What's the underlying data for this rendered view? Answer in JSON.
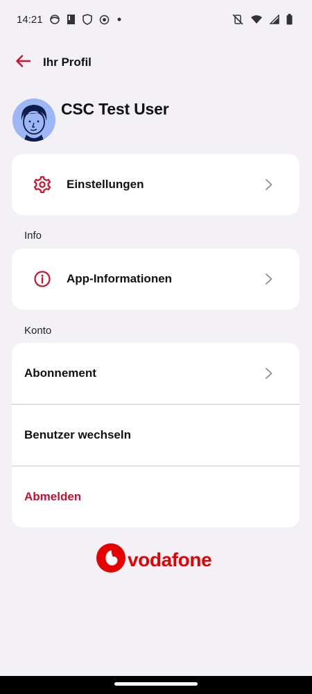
{
  "status_bar": {
    "time": "14:21",
    "left_icons": [
      "face-icon",
      "phone-tag-icon",
      "shield-icon",
      "record-icon",
      "dot-icon"
    ],
    "right_icons": [
      "vibrate-off-icon",
      "wifi-icon",
      "signal-icon",
      "battery-icon"
    ]
  },
  "header": {
    "back_icon": "arrow-left-icon",
    "title": "Ihr Profil"
  },
  "profile": {
    "avatar_icon": "user-avatar",
    "name": "CSC Test User"
  },
  "settings_card": {
    "icon": "gear-icon",
    "label": "Einstellungen"
  },
  "info_section": {
    "title": "Info",
    "item_icon": "info-icon",
    "item_label": "App-Informationen"
  },
  "account_section": {
    "title": "Konto",
    "items": [
      "Abonnement",
      "Benutzer wechseln",
      "Abmelden"
    ]
  },
  "logo": {
    "text": "vodafone"
  },
  "colors": {
    "accent": "#e60000",
    "danger": "#c8102e",
    "background": "#f3f1f6",
    "card": "#ffffff"
  }
}
